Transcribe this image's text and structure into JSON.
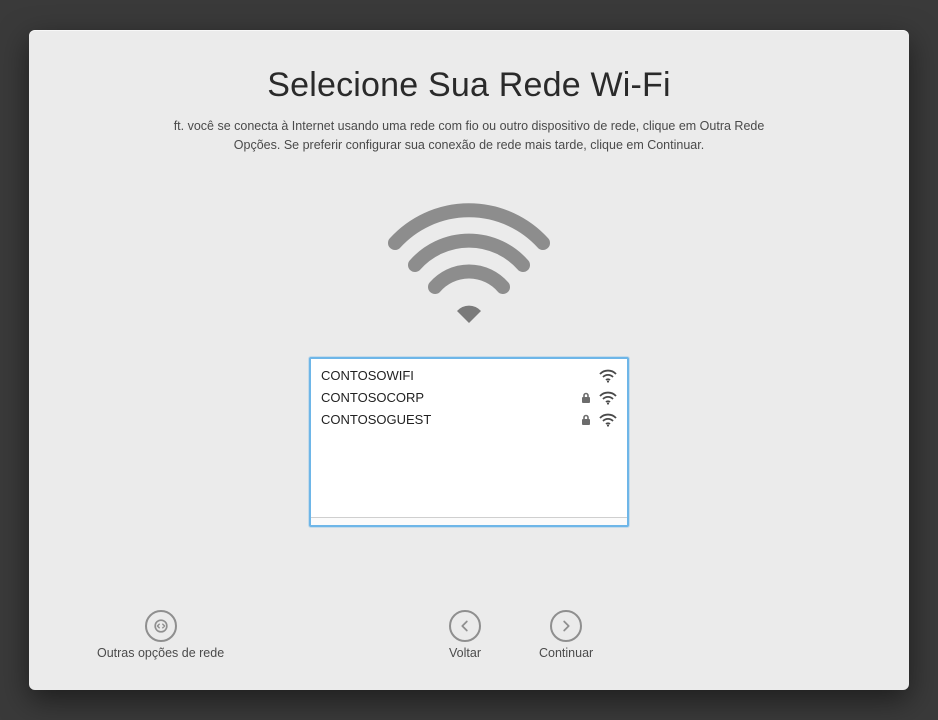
{
  "header": {
    "title": "Selecione Sua Rede Wi-Fi",
    "subtitle_line1": "ft. você se conecta à Internet usando uma rede com fio ou outro dispositivo de rede, clique em Outra Rede",
    "subtitle_line2": "Opções. Se preferir configurar sua conexão de rede mais tarde, clique em Continuar."
  },
  "networks": [
    {
      "name": "CONTOSOWIFI",
      "locked": false
    },
    {
      "name": "CONTOSOCORP",
      "locked": true
    },
    {
      "name": "CONTOSOGUEST",
      "locked": true
    }
  ],
  "footer": {
    "other_label": "Outras opções de rede",
    "back_label": "Voltar",
    "continue_label": "Continuar"
  }
}
